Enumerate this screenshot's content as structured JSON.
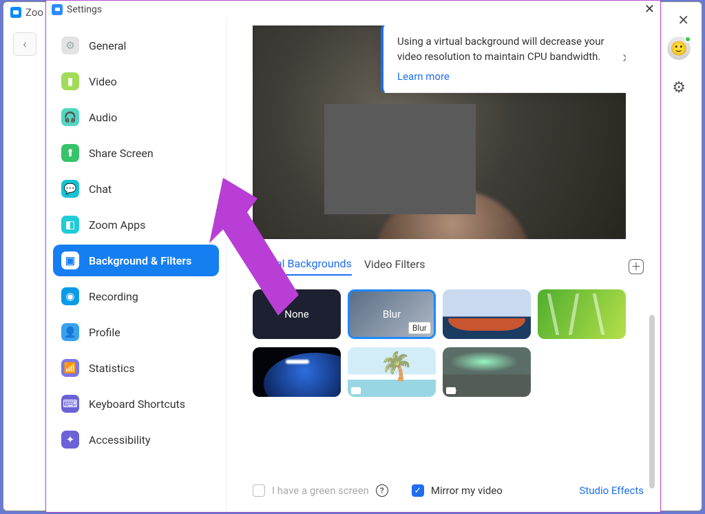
{
  "browser": {
    "tab_label": "Zoo",
    "back_icon_glyph": "‹"
  },
  "window": {
    "title": "Settings"
  },
  "sidebar": {
    "items": [
      {
        "label": "General",
        "icon_name": "general-icon"
      },
      {
        "label": "Video",
        "icon_name": "video-icon"
      },
      {
        "label": "Audio",
        "icon_name": "audio-icon"
      },
      {
        "label": "Share Screen",
        "icon_name": "share-screen-icon"
      },
      {
        "label": "Chat",
        "icon_name": "chat-icon"
      },
      {
        "label": "Zoom Apps",
        "icon_name": "zoom-apps-icon"
      },
      {
        "label": "Background & Filters",
        "icon_name": "background-filters-icon"
      },
      {
        "label": "Recording",
        "icon_name": "recording-icon"
      },
      {
        "label": "Profile",
        "icon_name": "profile-icon"
      },
      {
        "label": "Statistics",
        "icon_name": "statistics-icon"
      },
      {
        "label": "Keyboard Shortcuts",
        "icon_name": "keyboard-icon"
      },
      {
        "label": "Accessibility",
        "icon_name": "accessibility-icon"
      }
    ],
    "active_index": 6
  },
  "banner": {
    "text": "Using a virtual background will decrease your video resolution to maintain CPU bandwidth.",
    "link_label": "Learn more"
  },
  "tabs": {
    "items": [
      "Virtual Backgrounds",
      "Video Filters"
    ],
    "active_index": 0
  },
  "backgrounds": {
    "none_label": "None",
    "blur_label": "Blur",
    "blur_tooltip": "Blur",
    "selected_index": 1,
    "items": [
      "none",
      "blur",
      "golden-gate",
      "grass",
      "earth",
      "beach",
      "aurora"
    ]
  },
  "bottom": {
    "green_screen_label": "I have a green screen",
    "green_screen_checked": false,
    "mirror_label": "Mirror my video",
    "mirror_checked": true,
    "studio_label": "Studio Effects"
  }
}
